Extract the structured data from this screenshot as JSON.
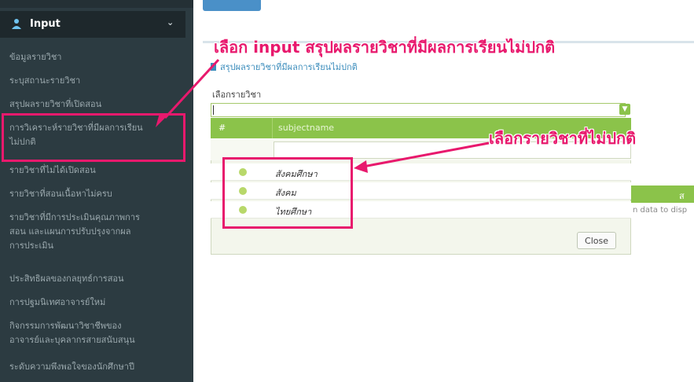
{
  "sidebar": {
    "header_label": "Input",
    "items": [
      {
        "label": "ข้อมูลรายวิชา"
      },
      {
        "label": "ระบุสถานะรายวิชา"
      },
      {
        "label": "สรุปผลรายวิชาที่เปิดสอน"
      },
      {
        "label": "การวิเคราะห์รายวิชาที่มีผลการเรียน"
      },
      {
        "label": "ไม่ปกติ"
      },
      {
        "label": "รายวิชาที่ไม่ได้เปิดสอน"
      },
      {
        "label": "รายวิชาที่สอนเนื้อหาไม่ครบ"
      },
      {
        "label": "รายวิชาที่มีการประเมินคุณภาพการ"
      },
      {
        "label": "สอน และแผนการปรับปรุงจากผล"
      },
      {
        "label": "การประเมิน"
      },
      {
        "label": "ประสิทธิผลของกลยุทธ์การสอน"
      },
      {
        "label": "การปฐมนิเทศอาจารย์ใหม่"
      },
      {
        "label": "กิจกรรมการพัฒนาวิชาชีพของ"
      },
      {
        "label": "อาจารย์และบุคลากรสายสนับสนุน"
      },
      {
        "label": "ระดับความพึงพอใจของนักศึกษาปี"
      }
    ]
  },
  "panel": {
    "title": "สรุปผลรายวิชาที่มีผลการเรียนไม่ปกติ",
    "select_label": "เลือกรายวิชา"
  },
  "dropdown": {
    "columns": [
      "#",
      "subjectname"
    ],
    "rows": [
      {
        "subjectname": "สังคมศึกษา"
      },
      {
        "subjectname": "สังคม"
      },
      {
        "subjectname": "ไทยศึกษา"
      }
    ],
    "close_label": "Close"
  },
  "right_table": {
    "header_label": "ส",
    "empty_text": "n data to disp"
  },
  "annotations": {
    "top": "เลือก input สรุปผลรายวิชาที่มีผลการเรียนไม่ปกติ",
    "middle": "เลือกรายวิชาที่ไม่ปกติ"
  },
  "colors": {
    "sidebar_bg": "#2c3b41",
    "accent_green": "#8bc34a",
    "annotation_pink": "#e8196d",
    "link_blue": "#3c8dbc"
  },
  "icons": {
    "header": "user-upload-icon",
    "chevron": "chevron-down-icon",
    "panel_title": "edit-icon",
    "select_toggle": "chevron-down-icon",
    "row_marker": "radio-dot-icon"
  }
}
